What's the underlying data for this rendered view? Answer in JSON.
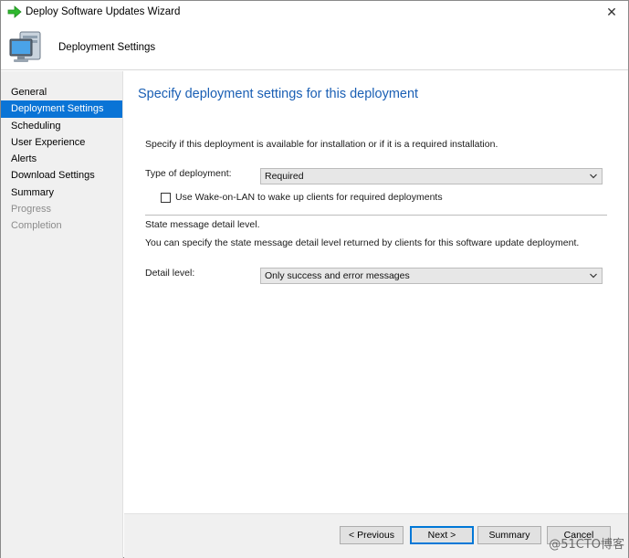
{
  "window": {
    "title": "Deploy Software Updates Wizard",
    "close_glyph": "✕"
  },
  "header": {
    "title": "Deployment Settings",
    "icon": "computer-icon"
  },
  "sidebar": {
    "items": [
      {
        "label": "General",
        "state": "normal"
      },
      {
        "label": "Deployment Settings",
        "state": "selected"
      },
      {
        "label": "Scheduling",
        "state": "normal"
      },
      {
        "label": "User Experience",
        "state": "normal"
      },
      {
        "label": "Alerts",
        "state": "normal"
      },
      {
        "label": "Download Settings",
        "state": "normal"
      },
      {
        "label": "Summary",
        "state": "normal"
      },
      {
        "label": "Progress",
        "state": "disabled"
      },
      {
        "label": "Completion",
        "state": "disabled"
      }
    ]
  },
  "main": {
    "heading": "Specify deployment settings for this deployment",
    "intro": "Specify if this deployment is available for installation or if it is a required installation.",
    "type_label": "Type of deployment:",
    "type_value": "Required",
    "wake_on_lan_label": "Use Wake-on-LAN to wake up clients for required deployments",
    "wake_on_lan_checked": false,
    "state_heading": "State message detail level.",
    "state_desc": "You can specify the state message detail level returned by clients for this software update deployment.",
    "detail_label": "Detail level:",
    "detail_value": "Only success and error messages"
  },
  "footer": {
    "previous": "< Previous",
    "next": "Next >",
    "summary": "Summary",
    "cancel": "Cancel"
  },
  "watermark": "@51CTO博客",
  "colors": {
    "accent": "#0a74d6",
    "heading": "#1a5fb4",
    "sidebar_bg": "#f0f0f0"
  }
}
